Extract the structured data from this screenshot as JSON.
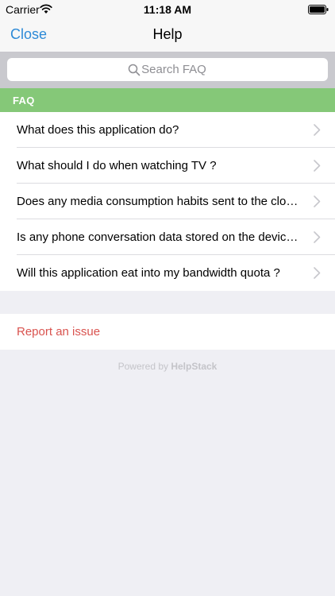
{
  "status_bar": {
    "carrier": "Carrier",
    "time": "11:18 AM",
    "wifi_icon": "wifi-icon",
    "battery_icon": "battery-icon"
  },
  "nav": {
    "close_label": "Close",
    "title": "Help"
  },
  "search": {
    "placeholder": "Search FAQ",
    "value": "",
    "icon": "search-icon"
  },
  "faq": {
    "header": "FAQ",
    "items": [
      {
        "label": "What does this application do?"
      },
      {
        "label": "What should I do when watching TV ?"
      },
      {
        "label": "Does any media consumption habits sent to the clou..."
      },
      {
        "label": "Is any phone conversation data stored on the device..."
      },
      {
        "label": "Will this application eat into my bandwidth quota ?"
      }
    ]
  },
  "report": {
    "label": "Report an issue"
  },
  "footer": {
    "powered_prefix": "Powered by ",
    "powered_brand": "HelpStack"
  },
  "colors": {
    "accent": "#2d8ad7",
    "faq_header_bg": "#85c878",
    "report_text": "#d9534f",
    "background": "#efeff4"
  }
}
